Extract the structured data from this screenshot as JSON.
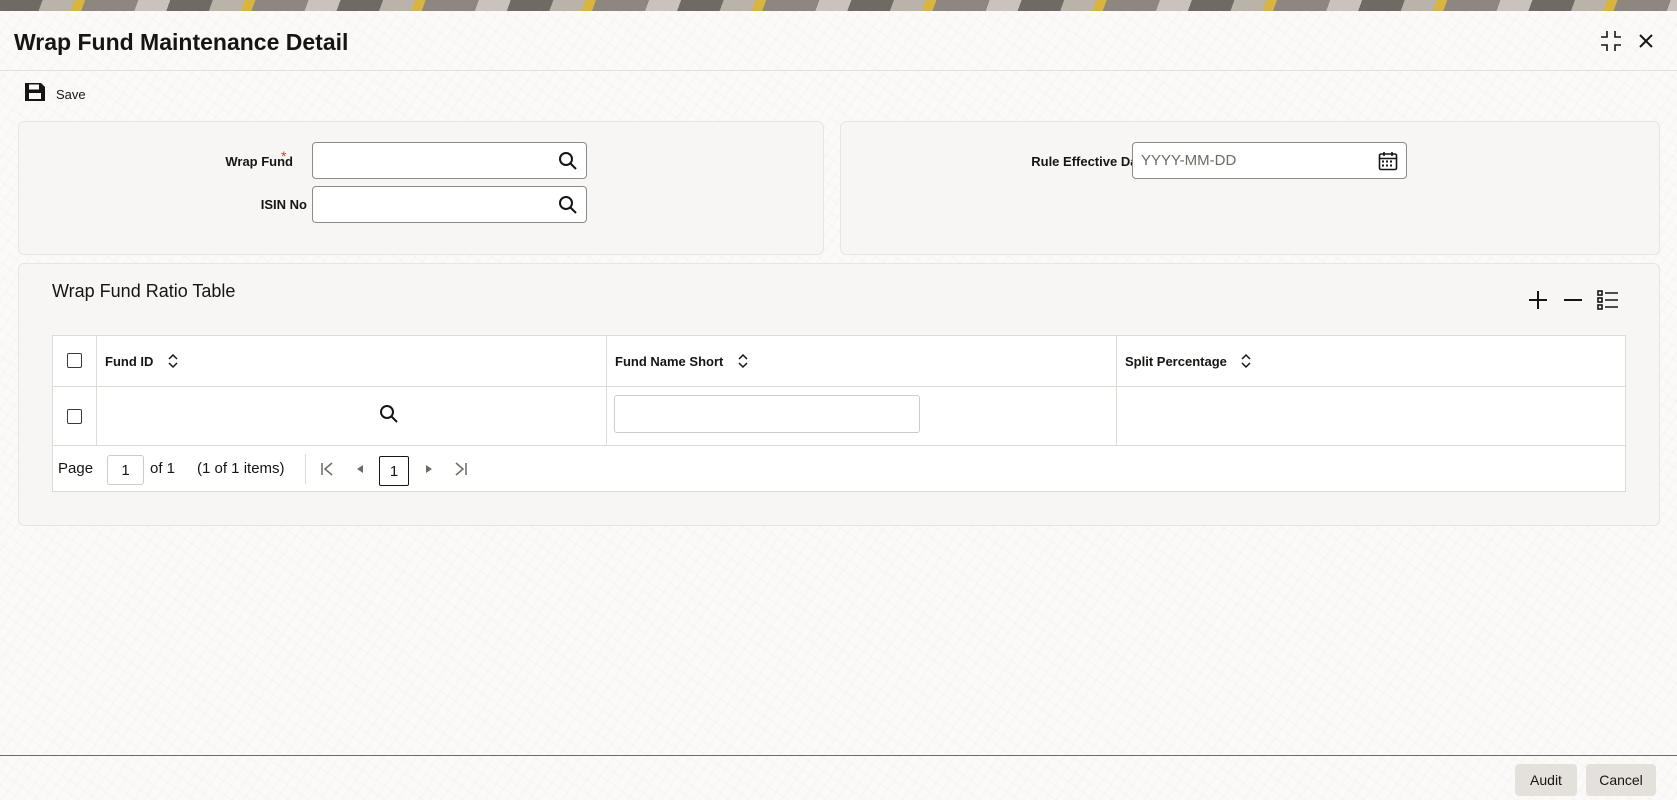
{
  "window": {
    "title": "Wrap Fund Maintenance Detail",
    "icons": {
      "maximize": "maximize-icon",
      "close": "close-icon"
    }
  },
  "toolbar": {
    "save_label": "Save",
    "save_icon": "floppy-disk-icon"
  },
  "form": {
    "wrap_fund": {
      "label": "Wrap Fund",
      "required_mark": "*",
      "value": "",
      "icon": "search-icon"
    },
    "isin_no": {
      "label": "ISIN No",
      "value": "",
      "icon": "search-icon"
    },
    "rule_effective_date": {
      "label": "Rule Effective Date",
      "placeholder": "YYYY-MM-DD",
      "value": "",
      "icon": "calendar-icon"
    }
  },
  "table": {
    "title": "Wrap Fund Ratio Table",
    "actions": [
      "add-row-icon",
      "remove-row-icon",
      "column-list-icon"
    ],
    "columns": [
      "Fund ID",
      "Fund Name Short",
      "Split Percentage"
    ],
    "rows": [
      {
        "fund_id": "",
        "fund_name_short": "",
        "split_percentage": ""
      }
    ],
    "pager": {
      "page_label": "Page",
      "current_page": "1",
      "of_label": "of 1",
      "items_label": "(1 of 1 items)",
      "page_button": "1"
    }
  },
  "footer": {
    "audit_label": "Audit",
    "cancel_label": "Cancel"
  },
  "colors": {
    "accent_red": "#c74634",
    "panel_bg": "#f7f6f4",
    "button_bg": "#e4e1dc"
  }
}
